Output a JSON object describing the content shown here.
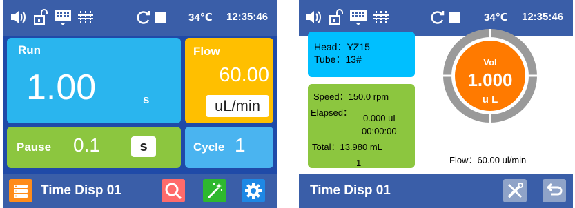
{
  "left_screen": {
    "status": {
      "temperature": "34℃",
      "time": "12:35:46"
    },
    "run": {
      "label": "Run",
      "value": "1.00",
      "unit": "s"
    },
    "flow": {
      "label": "Flow",
      "value": "60.00",
      "unit": "uL/min"
    },
    "pause": {
      "label": "Pause",
      "value": "0.1",
      "unit": "s"
    },
    "cycle": {
      "label": "Cycle",
      "value": "1"
    },
    "footer": {
      "title": "Time Disp 01"
    }
  },
  "right_screen": {
    "status": {
      "temperature": "34℃",
      "time": "12:35:46"
    },
    "head": {
      "label": "Head：",
      "value": "YZ15"
    },
    "tube": {
      "label": "Tube：",
      "value": "13#"
    },
    "speed": {
      "label": "Speed：",
      "value": "150.0 rpm"
    },
    "elapsed": {
      "label": "Elapsed：",
      "value": "0.000 uL",
      "time": "00:00:00"
    },
    "total": {
      "label": "Total：",
      "value": "13.980 mL"
    },
    "count": "1",
    "gauge": {
      "label": "Vol",
      "value": "1.000",
      "unit": "u L"
    },
    "flow": {
      "label": "Flow：",
      "value": "60.00 ul/min"
    },
    "footer": {
      "title": "Time Disp 01"
    }
  },
  "colors": {
    "status_bar": "#3a5ea8",
    "run_tile": "#2ab5ee",
    "flow_tile": "#ffbf00",
    "pause_tile": "#8cc63f",
    "cycle_tile": "#4ab4f0",
    "gauge_orange": "#ff7a00",
    "gauge_ring": "#999999"
  }
}
